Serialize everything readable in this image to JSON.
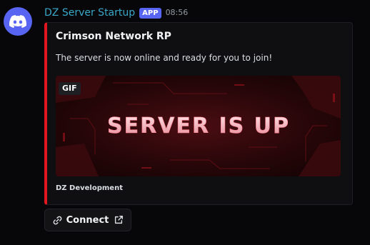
{
  "message": {
    "author": "DZ Server Startup",
    "badge": "APP",
    "timestamp": "08:56"
  },
  "embed": {
    "title": "Crimson Network RP",
    "description": "The server is now online and ready for you to join!",
    "image": {
      "badge": "GIF",
      "banner_text": "SERVER IS UP"
    },
    "footer": "DZ Development",
    "accent_color": "#e0171f"
  },
  "actions": {
    "connect_label": "Connect"
  },
  "icons": {
    "avatar": "discord-logo-icon",
    "connect_left": "link-icon",
    "connect_right": "external-link-icon"
  }
}
